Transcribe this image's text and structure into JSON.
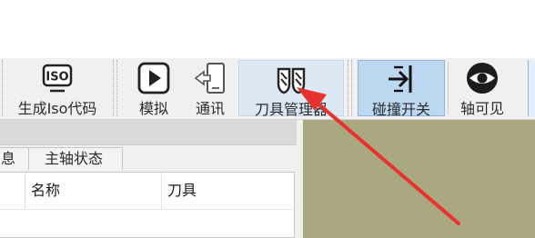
{
  "toolbar": {
    "buttons": [
      {
        "label": "生成Iso代码",
        "icon": "iso-icon"
      },
      {
        "label": "模拟",
        "icon": "play-icon"
      },
      {
        "label": "通讯",
        "icon": "device-transfer-icon"
      },
      {
        "label": "刀具管理器",
        "icon": "tool-manager-icon"
      },
      {
        "label": "碰撞开关",
        "icon": "collision-switch-icon"
      },
      {
        "label": "轴可见",
        "icon": "eye-icon"
      }
    ],
    "iso_icon_text": "ISO"
  },
  "panel": {
    "tabs": [
      "息",
      "主轴状态"
    ],
    "columns": [
      "名称",
      "刀具"
    ]
  },
  "colors": {
    "viewport_bg": "#aaa880",
    "hover_bg": "#dce8f4",
    "active_bg": "#bcd7f0",
    "annotation_arrow": "#e8322d"
  }
}
